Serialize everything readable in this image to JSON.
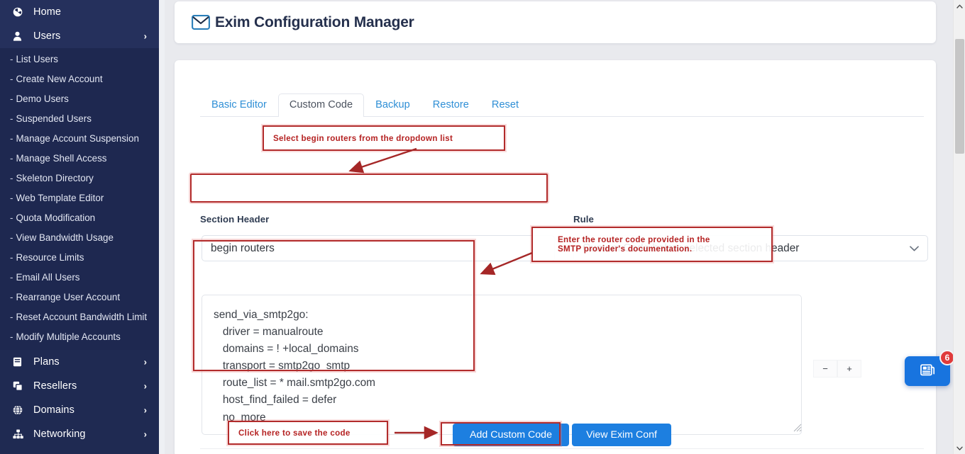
{
  "sidebar": {
    "top_items": [
      {
        "label": "Home",
        "icon": "dashboard-icon",
        "chevron": false
      },
      {
        "label": "Users",
        "icon": "user-icon",
        "chevron": true
      }
    ],
    "sub_items": [
      "List Users",
      "Create New Account",
      "Demo Users",
      "Suspended Users",
      "Manage Account Suspension",
      "Manage Shell Access",
      "Skeleton Directory",
      "Web Template Editor",
      "Quota Modification",
      "View Bandwidth Usage",
      "Resource Limits",
      "Email All Users",
      "Rearrange User Account",
      "Reset Account Bandwidth Limit",
      "Modify Multiple Accounts"
    ],
    "bottom_items": [
      {
        "label": "Plans",
        "icon": "book-icon",
        "chevron": true
      },
      {
        "label": "Resellers",
        "icon": "copy-icon",
        "chevron": true
      },
      {
        "label": "Domains",
        "icon": "globe-icon",
        "chevron": true
      },
      {
        "label": "Networking",
        "icon": "sitemap-icon",
        "chevron": true
      }
    ],
    "dash": "-"
  },
  "header": {
    "title": "Exim Configuration Manager",
    "icon": "envelope-icon"
  },
  "tabs": [
    {
      "label": "Basic Editor",
      "active": false
    },
    {
      "label": "Custom Code",
      "active": true
    },
    {
      "label": "Backup",
      "active": false
    },
    {
      "label": "Restore",
      "active": false
    },
    {
      "label": "Reset",
      "active": false
    }
  ],
  "form": {
    "section_header_label": "Section Header",
    "section_header_value": "begin routers",
    "section_header_placeholder": "begin routers",
    "rule_label": "Rule",
    "rule_value": "Custom Code below selected section header",
    "rule_options": [
      "Custom Code below selected section header"
    ]
  },
  "code_editor": {
    "value": "send_via_smtp2go:\n   driver = manualroute\n   domains = ! +local_domains\n   transport = smtp2go_smtp\n   route_list = * mail.smtp2go.com\n   host_find_failed = defer\n   no_more",
    "zoom_out_label": "−",
    "zoom_in_label": "+"
  },
  "buttons": {
    "add_custom_code": "Add Custom Code",
    "view_exim_conf": "View Exim Conf"
  },
  "annotations": [
    {
      "id": "anno-1",
      "text": "Select begin routers from the dropdown list"
    },
    {
      "id": "anno-2",
      "text": "Enter the router code provided in the\nSMTP provider's documentation."
    },
    {
      "id": "anno-3",
      "text": "Click here to save the code"
    }
  ],
  "floating_widget": {
    "icon": "news-icon",
    "badge": "6"
  },
  "scrollbar": {
    "up_arrow": "∧",
    "down_arrow": "∨"
  },
  "colors": {
    "sidebar_bg": "#1f2a52",
    "sidebar_sub_bg": "#1e2850",
    "accent_blue": "#1d7fe0",
    "tab_link": "#2f8fd6",
    "annotation_red": "#b22b2b",
    "badge_red": "#e03b3b",
    "page_bg": "#e9eaee"
  }
}
